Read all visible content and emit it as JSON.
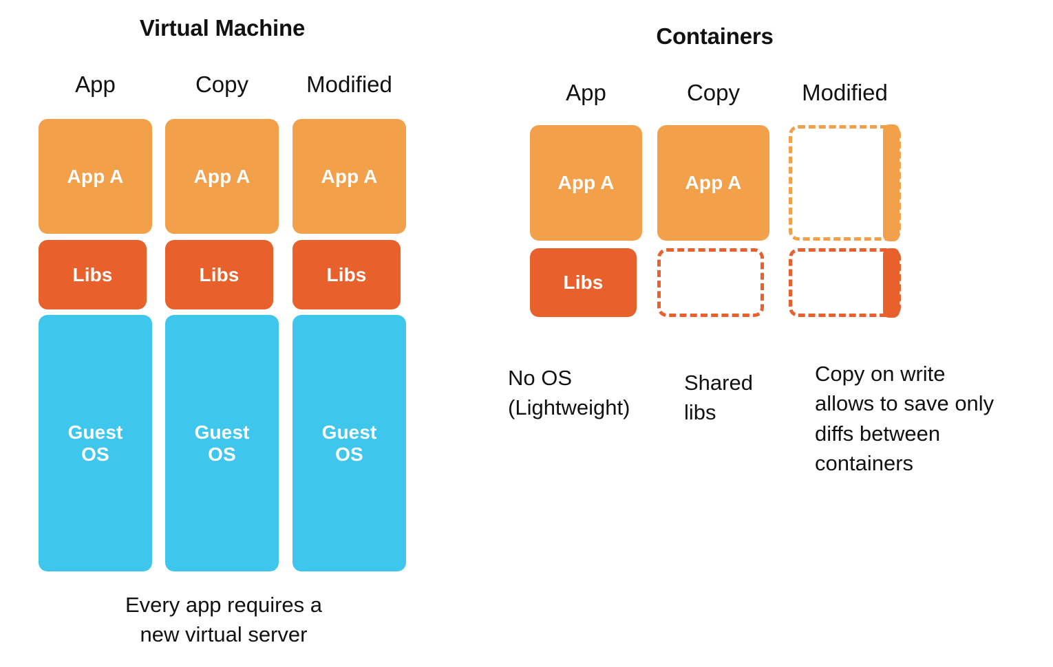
{
  "panels": [
    {
      "id": "virtual-machine",
      "title": "Virtual Machine",
      "columns": [
        {
          "label": "App",
          "app": "App A",
          "libs": "Libs",
          "os": "Guest\nOS"
        },
        {
          "label": "Copy",
          "app": "App A",
          "libs": "Libs",
          "os": "Guest\nOS"
        },
        {
          "label": "Modified",
          "app": "App A",
          "libs": "Libs",
          "os": "Guest\nOS"
        }
      ],
      "caption": "Every app requires a\nnew virtual server"
    },
    {
      "id": "containers",
      "title": "Containers",
      "columns": [
        {
          "label": "App",
          "app": "App A",
          "libs": "Libs"
        },
        {
          "label": "Copy",
          "app": "App A",
          "libs": ""
        },
        {
          "label": "Modified",
          "app": "",
          "libs": ""
        }
      ],
      "captions": [
        "No OS\n(Lightweight)",
        "Shared\nlibs",
        "Copy on write\nallows to save only\ndiffs between\ncontainers"
      ]
    }
  ],
  "labels": {
    "vm_title": "Virtual Machine",
    "containers_title": "Containers",
    "vm_col1": "App",
    "vm_col2": "Copy",
    "vm_col3": "Modified",
    "c_col1": "App",
    "c_col2": "Copy",
    "c_col3": "Modified",
    "app_a": "App A",
    "libs": "Libs",
    "guest_os_line1": "Guest",
    "guest_os_line2": "OS",
    "vm_caption_line1": "Every app requires a",
    "vm_caption_line2": "new virtual server",
    "c_caption1_line1": "No OS",
    "c_caption1_line2": "(Lightweight)",
    "c_caption2_line1": "Shared",
    "c_caption2_line2": "libs",
    "c_caption3_line1": "Copy on write",
    "c_caption3_line2": "allows to save only",
    "c_caption3_line3": "diffs between",
    "c_caption3_line4": "containers"
  },
  "colors": {
    "app_orange": "#F2A04A",
    "libs_red": "#E8602C",
    "guest_os_blue": "#3EC6ED",
    "text": "#111111",
    "background": "#FFFFFF"
  }
}
